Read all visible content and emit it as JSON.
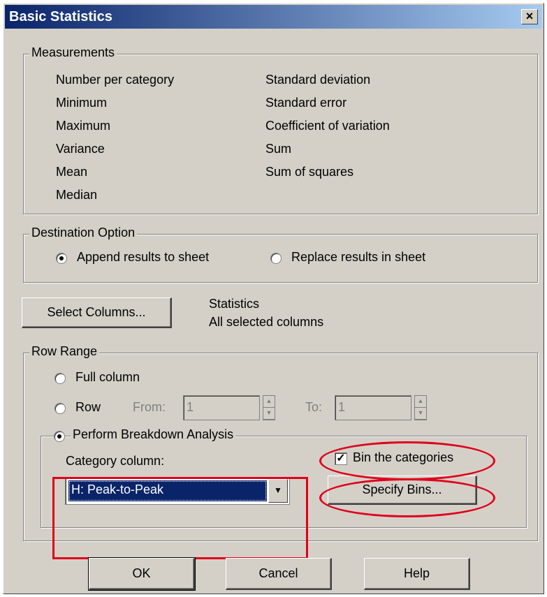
{
  "window": {
    "title": "Basic Statistics",
    "close_label": "×"
  },
  "measurements": {
    "legend": "Measurements",
    "left": [
      "Number per category",
      "Minimum",
      "Maximum",
      "Variance",
      "Mean",
      "Median"
    ],
    "right": [
      "Standard deviation",
      "Standard error",
      "Coefficient of variation",
      "Sum",
      "Sum of squares"
    ]
  },
  "destination": {
    "legend": "Destination Option",
    "append_label": "Append results to sheet",
    "replace_label": "Replace results in sheet",
    "selected": "append"
  },
  "select_columns": {
    "button_label": "Select Columns...",
    "info_line1": "Statistics",
    "info_line2": "All selected columns"
  },
  "row_range": {
    "legend": "Row Range",
    "full_column_label": "Full column",
    "row_label": "Row",
    "from_label": "From:",
    "from_value": "1",
    "to_label": "To:",
    "to_value": "1",
    "breakdown_label": "Perform Breakdown Analysis",
    "selected": "breakdown"
  },
  "breakdown": {
    "category_label": "Category column:",
    "category_value": "H: Peak-to-Peak",
    "bin_label": "Bin the categories",
    "bin_checked": true,
    "specify_bins_label": "Specify Bins..."
  },
  "buttons": {
    "ok": "OK",
    "cancel": "Cancel",
    "help": "Help"
  },
  "colors": {
    "title_start": "#0a246a",
    "title_end": "#a6caf0",
    "annotation": "#e0001a",
    "dialog_bg": "#d4d0c8"
  }
}
